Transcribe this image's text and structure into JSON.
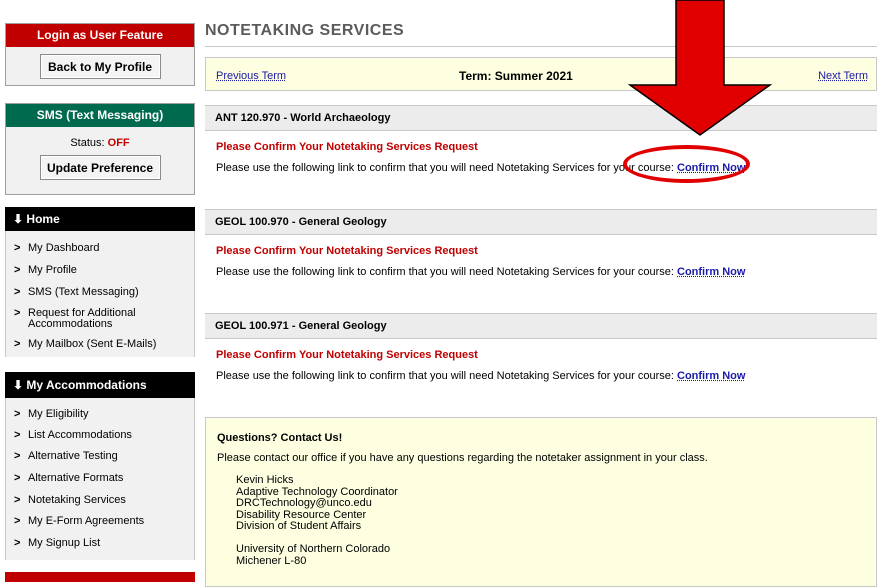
{
  "sidebar": {
    "login_header": "Login as User Feature",
    "back_button": "Back to My Profile",
    "sms_header": "SMS (Text Messaging)",
    "status_label": "Status:",
    "status_value": "OFF",
    "update_button": "Update Preference",
    "home_header": "Home",
    "home_items": [
      "My Dashboard",
      "My Profile",
      "SMS (Text Messaging)",
      "Request for Additional",
      "Accommodations",
      "My Mailbox (Sent E-Mails)"
    ],
    "accom_header": "My Accommodations",
    "accom_items": [
      "My Eligibility",
      "List Accommodations",
      "Alternative Testing",
      "Alternative Formats",
      "Notetaking Services",
      "My E-Form Agreements",
      "My Signup List"
    ]
  },
  "main": {
    "page_title": "NOTETAKING SERVICES",
    "prev_term": "Previous Term",
    "term_label": "Term: Summer 2021",
    "next_term": "Next Term",
    "courses": [
      {
        "name": "ANT 120.970 - World Archaeology"
      },
      {
        "name": "GEOL 100.970 - General Geology"
      },
      {
        "name": "GEOL 100.971 - General Geology"
      }
    ],
    "request_title": "Please Confirm Your Notetaking Services Request",
    "request_text": "Please use the following link to confirm that you will need Notetaking Services for your course:",
    "confirm_link": "Confirm Now",
    "contact": {
      "title": "Questions? Contact Us!",
      "text": "Please contact our office if you have any questions regarding the notetaker assignment in your class.",
      "lines": [
        "Kevin Hicks",
        "Adaptive Technology Coordinator",
        "DRCTechnology@unco.edu",
        "Disability Resource Center",
        "Division of Student Affairs",
        "",
        "University of Northern Colorado",
        "Michener L-80"
      ]
    }
  },
  "colors": {
    "sidebar_login": "#c00000",
    "sidebar_sms": "#006a4e",
    "annotation": "#e00000"
  }
}
